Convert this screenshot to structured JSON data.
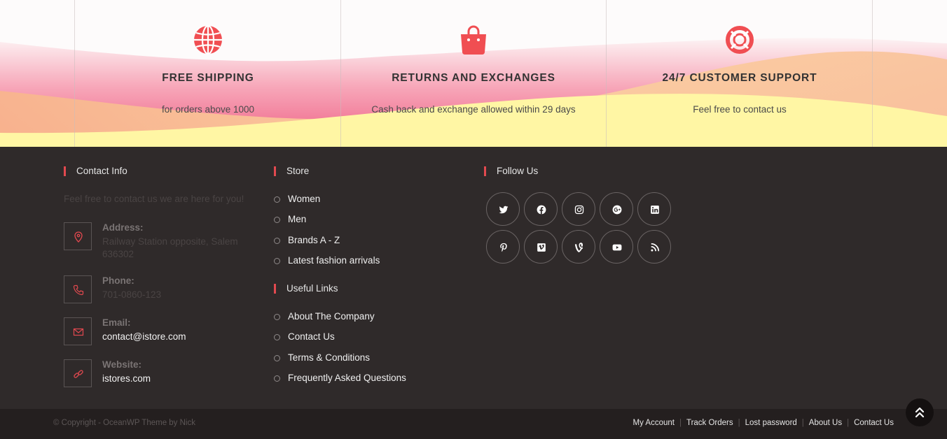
{
  "colors": {
    "accent": "#e2494f",
    "footer_bg": "#2f2a2a",
    "bottom_bg": "#241f1f",
    "wave_pink": "#f07a96",
    "wave_yellow": "#fff6a4"
  },
  "features": [
    {
      "icon": "globe-icon",
      "title": "FREE SHIPPING",
      "subtitle": "for orders above 1000"
    },
    {
      "icon": "shopping-bag-icon",
      "title": "RETURNS AND EXCHANGES",
      "subtitle": "Cash back and exchange allowed within 29 days"
    },
    {
      "icon": "lifebuoy-icon",
      "title": "24/7 CUSTOMER SUPPORT",
      "subtitle": "Feel free to contact us"
    }
  ],
  "contact": {
    "title": "Contact Info",
    "description": "Feel free to contact us we are here for you!",
    "address": {
      "icon": "map-pin-icon",
      "label": "Address:",
      "value": "Railway Station opposite, Salem 636302"
    },
    "phone": {
      "icon": "phone-icon",
      "label": "Phone:",
      "value": "701-0860-123"
    },
    "email": {
      "icon": "envelope-icon",
      "label": "Email:",
      "value": "contact@istore.com"
    },
    "website": {
      "icon": "link-icon",
      "label": "Website:",
      "value": "istores.com"
    }
  },
  "store": {
    "title": "Store",
    "items": [
      "Women",
      "Men",
      "Brands A - Z",
      "Latest fashion arrivals"
    ]
  },
  "useful_links": {
    "title": "Useful Links",
    "items": [
      "About The Company",
      "Contact Us",
      "Terms & Conditions",
      "Frequently Asked Questions"
    ]
  },
  "follow": {
    "title": "Follow Us",
    "icons": [
      "twitter-icon",
      "facebook-icon",
      "instagram-icon",
      "google-plus-icon",
      "linkedin-icon",
      "pinterest-icon",
      "vimeo-icon",
      "vine-icon",
      "youtube-icon",
      "rss-icon"
    ]
  },
  "bottom": {
    "copyright": "© Copyright - OceanWP Theme by Nick",
    "links": [
      "My Account",
      "Track Orders",
      "Lost password",
      "About Us",
      "Contact Us"
    ],
    "scroll_top_icon": "chevron-double-up-icon"
  }
}
